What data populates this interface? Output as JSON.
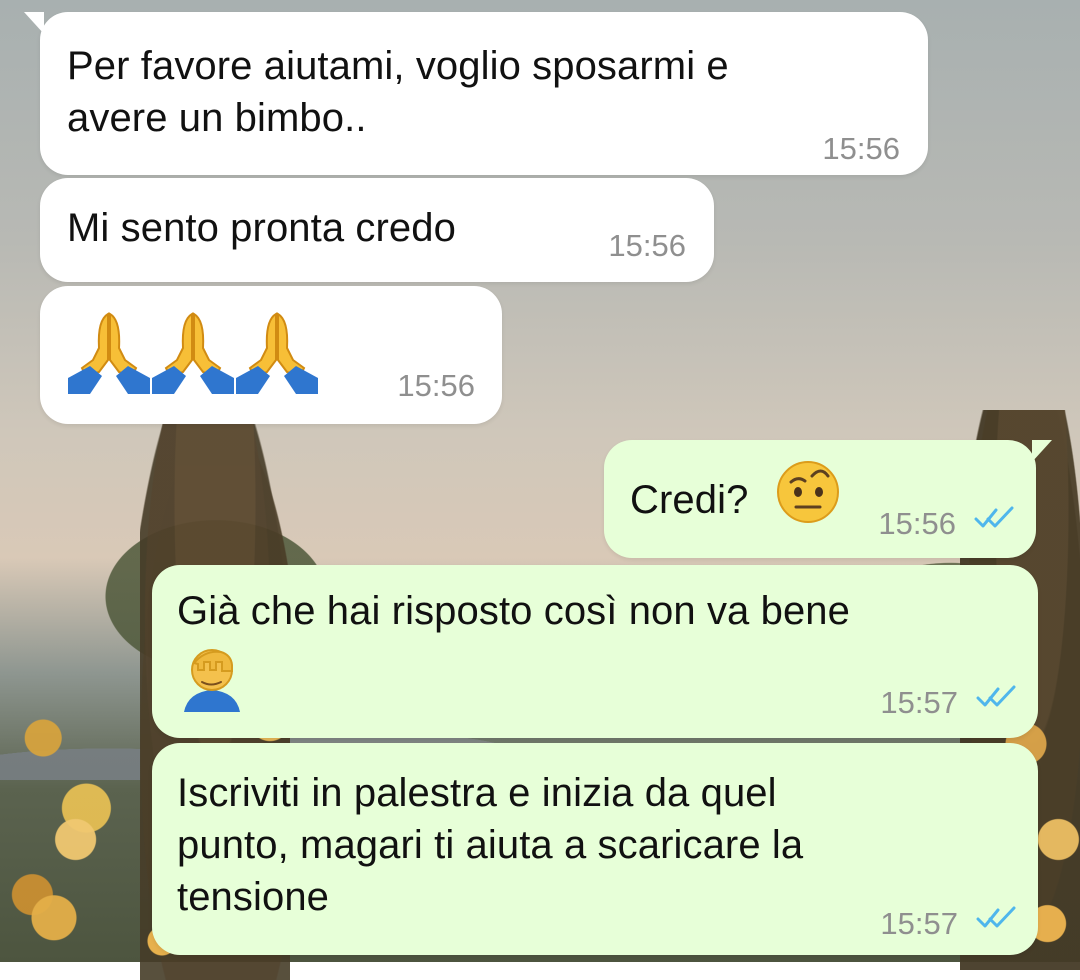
{
  "chat": {
    "messages": [
      {
        "direction": "incoming",
        "text": "Per favore aiutami, voglio sposarmi e\navere un bimbo..",
        "time": "15:56"
      },
      {
        "direction": "incoming",
        "text": "Mi sento pronta credo",
        "time": "15:56"
      },
      {
        "direction": "incoming",
        "text": "",
        "emoji": [
          "folded-hands-icon",
          "folded-hands-icon",
          "folded-hands-icon"
        ],
        "time": "15:56"
      },
      {
        "direction": "outgoing",
        "text": "Credi?",
        "emoji": [
          "face-with-raised-eyebrow-icon"
        ],
        "time": "15:56",
        "status": "read"
      },
      {
        "direction": "outgoing",
        "text": "Già che hai risposto così non va bene",
        "emoji": [
          "person-facepalming-icon"
        ],
        "time": "15:57",
        "status": "read"
      },
      {
        "direction": "outgoing",
        "text": "Iscriviti in palestra e inizia da quel\npunto, magari ti aiuta a scaricare la\ntensione",
        "time": "15:57",
        "status": "read"
      }
    ]
  },
  "colors": {
    "incoming_bubble": "#ffffff",
    "outgoing_bubble": "#e7ffd8",
    "timestamp": "#8f8f8f",
    "read_ticks": "#4fb6ec"
  }
}
